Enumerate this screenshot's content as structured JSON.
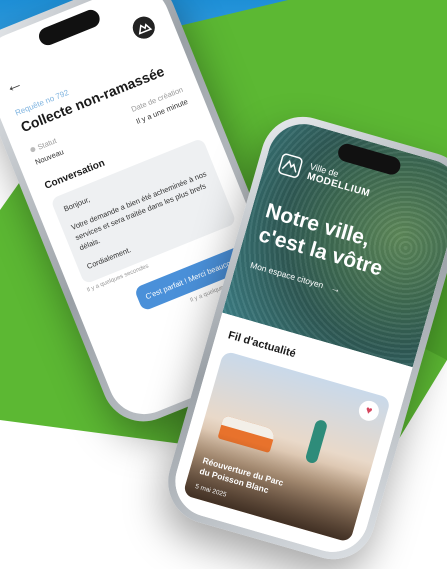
{
  "colors": {
    "accent_blue": "#1e8fd6",
    "accent_green": "#5cb833",
    "button_blue": "#4a90d9",
    "heart_red": "#d6455d"
  },
  "left_phone": {
    "back_icon": "arrow-left-icon",
    "logo_icon": "mountain-logo-icon",
    "request_number": "Requête no 792",
    "title": "Collecte non-ramassée",
    "status_label": "Statut",
    "status_value": "Nouveau",
    "created_label": "Date de création",
    "created_value": "Il y a une minute",
    "conversation_title": "Conversation",
    "message": [
      "Bonjour,",
      "Votre demande a bien été acheminée à nos services et sera traitée dans les plus brefs délais.",
      "Cordialement."
    ],
    "message_time": "Il y a quelques secondes",
    "reply_button": "C'est parfait ! Merci beaucoup",
    "reply_time": "Il y a quelques secondes"
  },
  "right_phone": {
    "brand_line1": "Ville de",
    "brand_line2": "MODELLIUM",
    "slogan_line1": "Notre ville,",
    "slogan_line2": "c'est la vôtre",
    "space_link": "Mon espace citoyen",
    "space_arrow": "→",
    "feed_title": "Fil d'actualité",
    "news_title_line1": "Réouverture du Parc",
    "news_title_line2": "du Poisson Blanc",
    "news_date": "5 mai 2025",
    "heart_symbol": "♥"
  }
}
